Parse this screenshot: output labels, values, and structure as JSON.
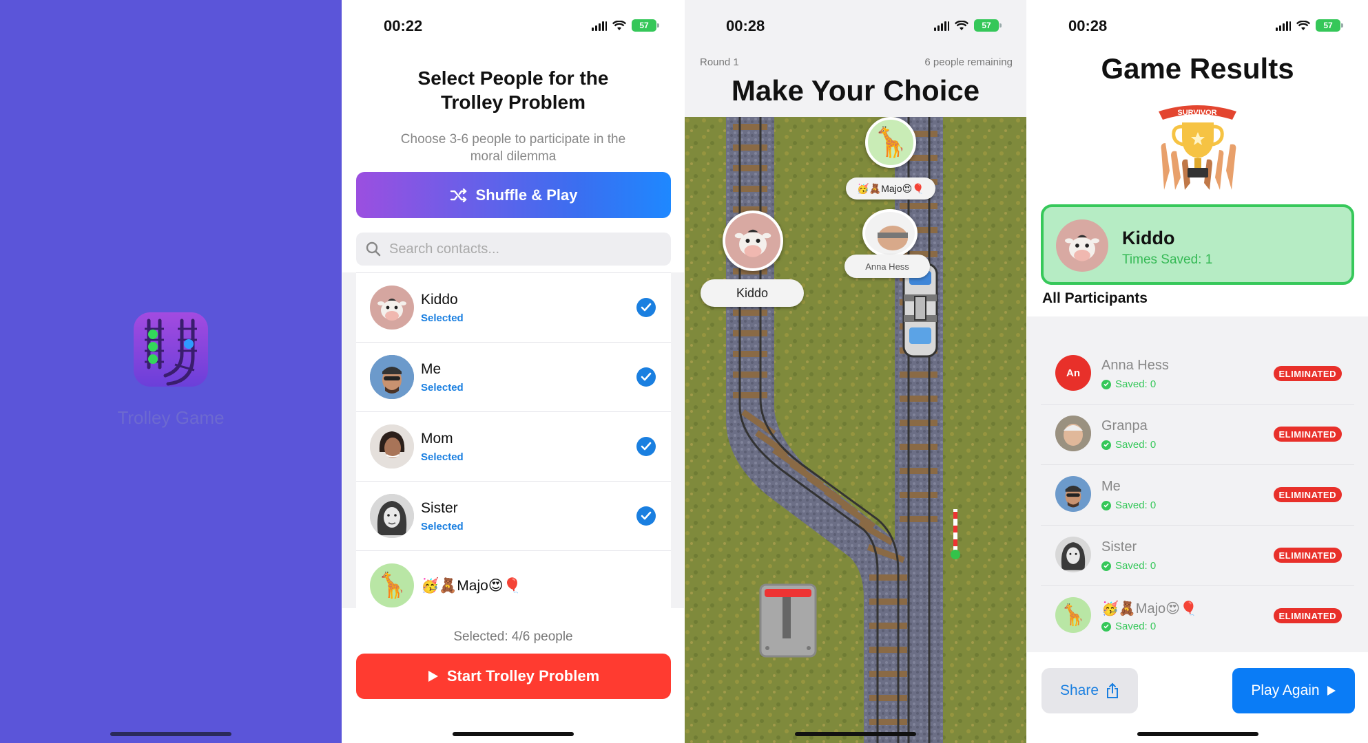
{
  "launch": {
    "app_name": "Trolley Game",
    "icon_colors": [
      "#a34be0",
      "#33d85a",
      "#2e9bff"
    ]
  },
  "select": {
    "time": "00:22",
    "battery": "57",
    "title_line1": "Select People for the",
    "title_line2": "Trolley Problem",
    "subtitle": "Choose 3-6 people to participate in the moral dilemma",
    "shuffle_label": "Shuffle & Play",
    "search_placeholder": "Search contacts...",
    "contacts": [
      {
        "name": "Kiddo",
        "status": "Selected",
        "emoji": "🐮"
      },
      {
        "name": "Me",
        "status": "Selected",
        "emoji": ""
      },
      {
        "name": "Mom",
        "status": "Selected",
        "emoji": ""
      },
      {
        "name": "Sister",
        "status": "Selected",
        "emoji": ""
      },
      {
        "name": "🥳🧸Majo😍🎈",
        "status": "",
        "emoji": "🦒"
      }
    ],
    "selected_count": "Selected: 4/6 people",
    "start_label": "Start Trolley Problem"
  },
  "game": {
    "time": "00:28",
    "battery": "57",
    "round": "Round 1",
    "remaining": "6 people remaining",
    "title": "Make Your Choice",
    "left_track_label": "Kiddo",
    "right_track_label": "🥳🧸Majo😍🎈",
    "right_track_label2": "Anna Hess"
  },
  "results": {
    "time": "00:28",
    "battery": "57",
    "title": "Game Results",
    "survivor_banner": "SURVIVOR",
    "winner_name": "Kiddo",
    "winner_saved": "Times Saved: 1",
    "all_participants": "All Participants",
    "participants": [
      {
        "name": "Anna Hess",
        "initials": "An",
        "saved": "Saved: 0",
        "badge": "ELIMINATED"
      },
      {
        "name": "Granpa",
        "initials": "",
        "saved": "Saved: 0",
        "badge": "ELIMINATED"
      },
      {
        "name": "Me",
        "initials": "",
        "saved": "Saved: 0",
        "badge": "ELIMINATED"
      },
      {
        "name": "Sister",
        "initials": "",
        "saved": "Saved: 0",
        "badge": "ELIMINATED"
      },
      {
        "name": "🥳🧸Majo😍🎈",
        "initials": "",
        "saved": "Saved: 0",
        "badge": "ELIMINATED"
      }
    ],
    "share_label": "Share",
    "play_again_label": "Play Again"
  }
}
